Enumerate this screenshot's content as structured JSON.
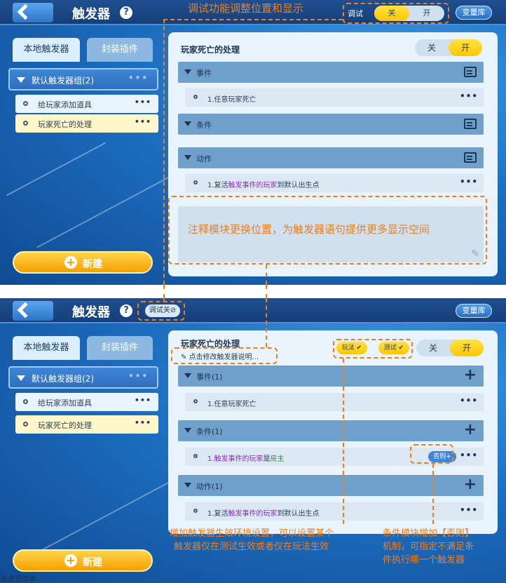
{
  "app": {
    "title": "触发器",
    "help": "?",
    "var_library": "变量库",
    "debug_label": "调试",
    "debug_off": "关",
    "debug_on": "开",
    "debug_status": "调试关⊘"
  },
  "sidebar": {
    "tabs": [
      "本地触发器",
      "封装插件"
    ],
    "group": {
      "label": "默认触发器组(2)",
      "more": "•••"
    },
    "items": [
      {
        "label": "给玩家添加道具",
        "more": "•••"
      },
      {
        "label": "玩家死亡的处理",
        "more": "•••"
      }
    ],
    "new_button": "新建"
  },
  "top_panel": {
    "rule_name": "玩家死亡的处理",
    "toggle": {
      "off": "关",
      "on": "开"
    },
    "sections": {
      "events": {
        "label": "事件",
        "row": "1.任意玩家死亡"
      },
      "conditions": {
        "label": "条件"
      },
      "actions": {
        "label": "动作",
        "row_prefix": "1.复活",
        "row_mid": "触发事件的玩家",
        "row_suffix": "到默认出生点"
      }
    }
  },
  "bottom_panel": {
    "rule_name": "玩家死亡的处理",
    "desc_hint": "点击修改触发器说明...",
    "badges": {
      "play": "玩法",
      "test": "测试"
    },
    "toggle": {
      "off": "关",
      "on": "开"
    },
    "sections": {
      "events": {
        "label": "事件(1)",
        "row": "1.任意玩家死亡"
      },
      "conditions": {
        "label": "条件(1)",
        "row_prefix": "1.",
        "row_mid": "触发事件的玩家",
        "row_is": "是",
        "row_suffix": "房主",
        "else": "否则+"
      },
      "actions": {
        "label": "动作(1)",
        "row_prefix": "1.复活",
        "row_mid": "触发事件的玩家",
        "row_suffix": "到默认出生点"
      }
    }
  },
  "annotations": {
    "debug_move": "调试功能调整位置和显示",
    "notes_move": "注释模块更换位置，为触发器语句提供更多显示空间",
    "env_line1": "增加触发器生效环境设置，可以设置某个",
    "env_line2": "触发器仅在测试生效或者仅在玩法生效",
    "else_line1": "条件模块增加【否则】",
    "else_line2": "机制，可指定不满足条",
    "else_line3": "件执行哪一个触发器"
  },
  "footer": "先遣服版本",
  "colors": {
    "annotation_orange": "#f07e1e",
    "toggle_yellow": "#ffc700",
    "header_blue": "#1f4f91"
  }
}
